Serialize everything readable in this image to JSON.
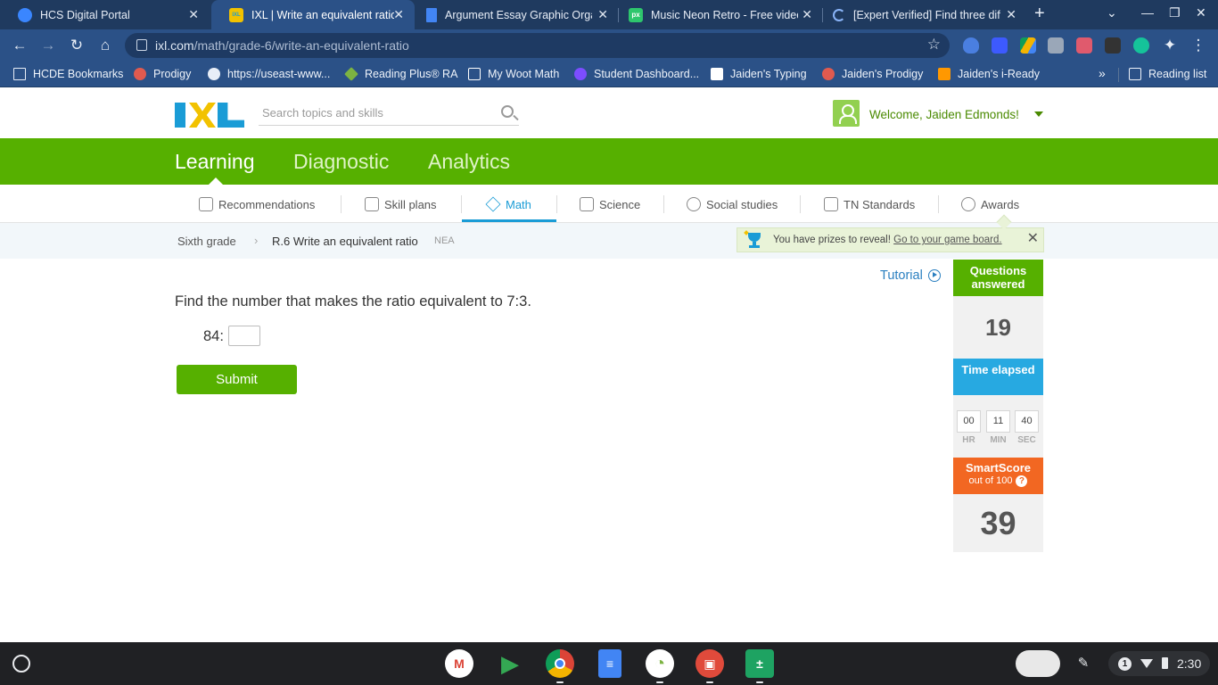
{
  "browser": {
    "tabs": [
      {
        "title": "HCS Digital Portal",
        "favicon": "hcs-cloud-icon",
        "color": "#3a86ff",
        "glyph": ""
      },
      {
        "title": "IXL | Write an equivalent ratio",
        "favicon": "ixl-icon",
        "color": "#f2c200",
        "glyph": "IXL"
      },
      {
        "title": "Argument Essay Graphic Orga",
        "favicon": "google-docs-icon",
        "color": "#4285f4",
        "glyph": ""
      },
      {
        "title": "Music Neon Retro - Free video",
        "favicon": "pixabay-icon",
        "color": "#2ec66d",
        "glyph": "px"
      },
      {
        "title": "[Expert Verified] Find three diff",
        "favicon": "loading-spinner-icon",
        "color": "#8ab4f8",
        "glyph": ""
      }
    ],
    "url": "ixl.com",
    "url_path": "/math/grade-6/write-an-equivalent-ratio",
    "bookmarks": [
      {
        "label": "HCDE Bookmarks",
        "icon": "folder-icon",
        "color": "#e8eef7"
      },
      {
        "label": "Prodigy",
        "icon": "prodigy-icon",
        "color": "#e05a4f"
      },
      {
        "label": "https://useast-www...",
        "icon": "globe-icon",
        "color": "#e8eef7"
      },
      {
        "label": "Reading Plus® RA",
        "icon": "reading-plus-icon",
        "color": "#7cb342"
      },
      {
        "label": "My Woot Math",
        "icon": "woot-math-icon",
        "color": "#ffffff"
      },
      {
        "label": "Student Dashboard...",
        "icon": "student-dashboard-icon",
        "color": "#7c4dff"
      },
      {
        "label": "Jaiden's Typing",
        "icon": "typing-icon",
        "color": "#ffffff"
      },
      {
        "label": "Jaiden's Prodigy",
        "icon": "prodigy-icon",
        "color": "#e05a4f"
      },
      {
        "label": "Jaiden's i-Ready",
        "icon": "iready-icon",
        "color": "#ff9800"
      }
    ],
    "reading_list": "Reading list"
  },
  "header": {
    "search_placeholder": "Search topics and skills",
    "welcome": "Welcome, Jaiden Edmonds!",
    "colors": {
      "logo_blue": "#1a9cd6",
      "logo_yellow": "#f2c200",
      "green": "#56b000"
    }
  },
  "main_nav": [
    {
      "label": "Learning",
      "active": true
    },
    {
      "label": "Diagnostic",
      "active": false
    },
    {
      "label": "Analytics",
      "active": false
    }
  ],
  "subject_nav": [
    {
      "label": "Recommendations",
      "icon": "recommendations-icon"
    },
    {
      "label": "Skill plans",
      "icon": "skill-plans-icon"
    },
    {
      "label": "Math",
      "icon": "math-pyramid-icon",
      "active": true
    },
    {
      "label": "Science",
      "icon": "science-flask-icon"
    },
    {
      "label": "Social studies",
      "icon": "globe-icon"
    },
    {
      "label": "TN Standards",
      "icon": "standards-icon"
    },
    {
      "label": "Awards",
      "icon": "awards-icon"
    }
  ],
  "breadcrumb": {
    "grade": "Sixth grade",
    "skill": "R.6 Write an equivalent ratio",
    "code": "NEA"
  },
  "prize_banner": {
    "text": "You have prizes to reveal!",
    "link": "Go to your game board."
  },
  "question": {
    "tutorial": "Tutorial",
    "prompt": "Find the number that makes the ratio equivalent to 7:3.",
    "ratio_prefix": "84:",
    "answer_value": "",
    "submit": "Submit"
  },
  "stats": {
    "questions_label": "Questions answered",
    "questions_value": "19",
    "time_label": "Time elapsed",
    "time": {
      "hr": "00",
      "min": "11",
      "sec": "40"
    },
    "time_units": {
      "hr": "HR",
      "min": "MIN",
      "sec": "SEC"
    },
    "smartscore_label": "SmartScore",
    "smartscore_sub": "out of 100",
    "smartscore_value": "39",
    "colors": {
      "questions": "#56b000",
      "time": "#27a9e1",
      "smartscore": "#f26722"
    }
  },
  "shelf": {
    "apps": [
      {
        "name": "gmail-app",
        "color": "#ffffff",
        "glyph": "M"
      },
      {
        "name": "play-store-app",
        "color": "#ffffff",
        "glyph": "▶"
      },
      {
        "name": "chrome-app",
        "color": "#db4437",
        "glyph": ""
      },
      {
        "name": "google-docs-app",
        "color": "#4285f4",
        "glyph": "≡"
      },
      {
        "name": "timer-app",
        "color": "#ffffff",
        "glyph": "◔"
      },
      {
        "name": "gallery-app",
        "color": "#e04a3b",
        "glyph": "▣"
      },
      {
        "name": "calculator-app",
        "color": "#1ea362",
        "glyph": "±"
      }
    ],
    "time": "2:30",
    "notification_count": "1"
  }
}
